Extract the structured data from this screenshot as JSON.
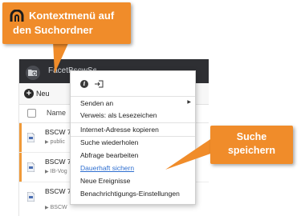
{
  "callouts": {
    "top": {
      "line1": "Kontextmenü auf",
      "line2": "den Suchordner"
    },
    "right": {
      "line1": "Suche",
      "line2": "speichern"
    }
  },
  "app": {
    "title": "FacetBscwSearch",
    "toolbar": {
      "new_label": "Neu"
    },
    "list": {
      "header": {
        "name_label": "Name"
      },
      "rows": [
        {
          "title": "BSCW 7",
          "subtitle": "public"
        },
        {
          "title": "BSCW 7",
          "subtitle": "IB-Vog"
        },
        {
          "title": "BSCW 7",
          "subtitle": ""
        },
        {
          "title": "BSCW 7",
          "subtitle": "BSCW"
        }
      ]
    }
  },
  "context_menu": {
    "items": [
      {
        "label": "Senden an",
        "has_submenu": true
      },
      {
        "label": "Verweis: als Lesezeichen"
      },
      {
        "label": "Internet-Adresse kopieren"
      },
      {
        "label": "Suche wiederholen"
      },
      {
        "label": "Abfrage bearbeiten"
      },
      {
        "label": "Dauerhaft sichern",
        "highlighted_link": true
      },
      {
        "label": "Neue Ereignisse"
      },
      {
        "label": "Benachrichtigungs-Einstellungen"
      }
    ]
  },
  "colors": {
    "callout": "#f08c2a",
    "header": "#2e2f33",
    "link": "#2f6fd0",
    "row_accent": "#f09a38"
  }
}
